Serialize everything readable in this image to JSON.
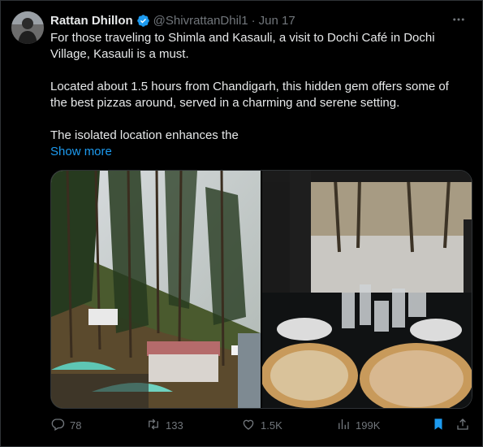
{
  "tweet": {
    "author_name": "Rattan Dhillon",
    "handle": "@ShivrattanDhil1",
    "separator": "·",
    "date": "Jun 17",
    "paragraphs": [
      "For those traveling to Shimla and Kasauli, a visit to Dochi Café in Dochi Village, Kasauli is a must.",
      "Located about 1.5 hours from Chandigarh, this hidden gem offers some of the best pizzas around, served in a charming and serene setting.",
      "The isolated location enhances the"
    ],
    "show_more": "Show more"
  },
  "actions": {
    "replies": "78",
    "reposts": "133",
    "likes": "1.5K",
    "views": "199K"
  },
  "icons": {
    "verified": "verified-badge-icon",
    "more": "more-options-icon",
    "reply": "reply-icon",
    "repost": "repost-icon",
    "like": "heart-icon",
    "views": "views-icon",
    "bookmark": "bookmark-icon",
    "share": "share-icon"
  },
  "colors": {
    "background": "#000000",
    "text": "#e7e9ea",
    "muted": "#71767b",
    "link": "#1d9bf0",
    "bookmark_active": "#1d9bf0"
  }
}
